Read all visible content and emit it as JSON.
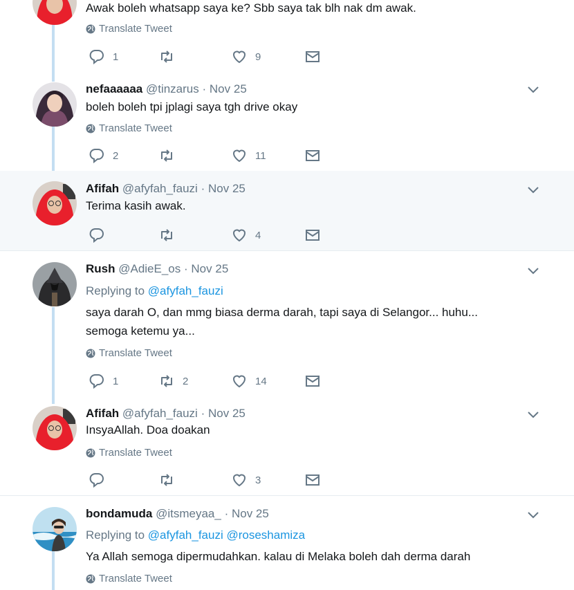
{
  "tweets": [
    {
      "text": "Awak boleh whatsapp saya ke? Sbb saya tak blh nak dm awak.",
      "translate": "Translate Tweet",
      "replies": "1",
      "retweets": "",
      "likes": "9"
    },
    {
      "name": "nefaaaaaa",
      "handle": "@tinzarus",
      "dot": "·",
      "date": "Nov 25",
      "text": "boleh boleh tpi jplagi saya tgh drive okay",
      "translate": "Translate Tweet",
      "replies": "2",
      "retweets": "",
      "likes": "11"
    },
    {
      "name": "Afifah",
      "handle": "@afyfah_fauzi",
      "dot": "·",
      "date": "Nov 25",
      "text": "Terima kasih awak.",
      "replies": "",
      "retweets": "",
      "likes": "4"
    },
    {
      "name": "Rush",
      "handle": "@AdieE_os",
      "dot": "·",
      "date": "Nov 25",
      "replying_prefix": "Replying to",
      "replying_mentions": [
        "@afyfah_fauzi"
      ],
      "text_lines": [
        "saya darah O, dan mmg biasa derma darah, tapi saya di Selangor... huhu...",
        "semoga ketemu ya..."
      ],
      "translate": "Translate Tweet",
      "replies": "1",
      "retweets": "2",
      "likes": "14"
    },
    {
      "name": "Afifah",
      "handle": "@afyfah_fauzi",
      "dot": "·",
      "date": "Nov 25",
      "text": "InsyaAllah. Doa doakan",
      "translate": "Translate Tweet",
      "replies": "",
      "retweets": "",
      "likes": "3"
    },
    {
      "name": "bondamuda",
      "handle": "@itsmeyaa_",
      "dot": "·",
      "date": "Nov 25",
      "replying_prefix": "Replying to",
      "replying_mentions": [
        "@afyfah_fauzi",
        "@roseshamiza"
      ],
      "text": "Ya Allah semoga dipermudahkan. kalau di Melaka boleh dah derma darah",
      "translate": "Translate Tweet"
    }
  ],
  "icons": {
    "reply": "reply-icon",
    "retweet": "retweet-icon",
    "like": "heart-icon",
    "dm": "envelope-icon",
    "globe": "globe-icon",
    "caret": "chevron-down-icon"
  },
  "colors": {
    "mention": "#1b95e0",
    "secondary_text": "#657786",
    "thread_line": "#c4def2",
    "highlight_bg": "#f5f8fa",
    "separator": "#e6ecf0"
  }
}
